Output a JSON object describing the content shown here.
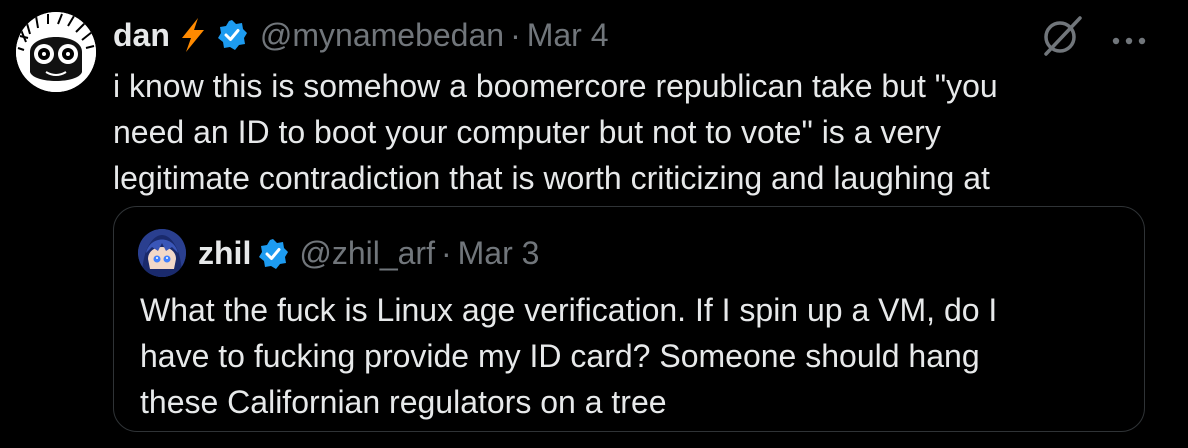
{
  "colors": {
    "background": "#000000",
    "primary_text": "#e7e9ea",
    "secondary_text": "#71767b",
    "verified_blue": "#1d9bf0",
    "bolt_orange": "#ff8a00",
    "border": "#2f3336"
  },
  "tweet": {
    "author_name": "dan",
    "handle": "@mynamebedan",
    "separator": "·",
    "date": "Mar 4",
    "text": "i know this is somehow a boomercore republican take but \"you\nneed an ID to boot your computer but not to vote\" is a very\nlegitimate contradiction that is worth criticizing and laughing at",
    "icons": {
      "avatar": "avatar-icon",
      "emoji": "lightning-bolt-icon",
      "verified": "verified-badge-icon",
      "grok": "grok-icon",
      "more": "more-options-icon"
    }
  },
  "quoted_tweet": {
    "author_name": "zhil",
    "handle": "@zhil_arf",
    "separator": "·",
    "date": "Mar 3",
    "text": "What the fuck is Linux age verification. If I spin up a VM, do I\nhave to fucking provide my ID card? Someone should hang\nthese Californian regulators on a tree"
  }
}
